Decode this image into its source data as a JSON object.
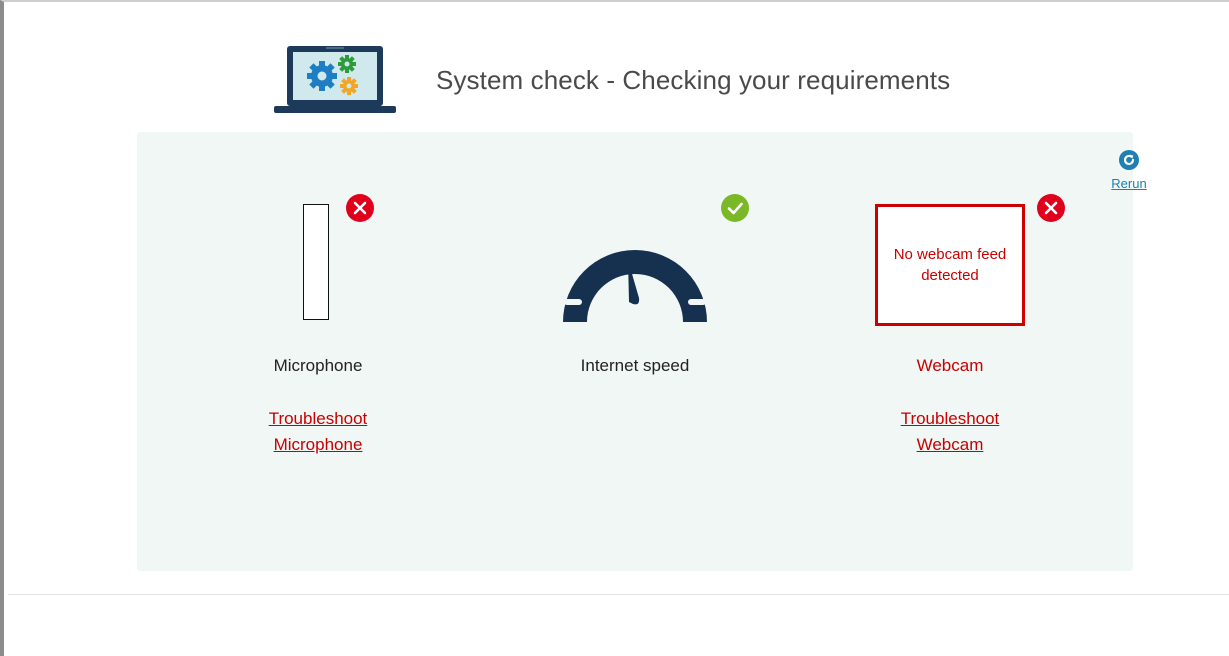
{
  "header": {
    "title": "System check - Checking your requirements",
    "icon": "laptop-gears-icon"
  },
  "rerun": {
    "label": "Rerun",
    "icon": "refresh-icon"
  },
  "checks": [
    {
      "label": "Microphone",
      "status": "fail",
      "troubleshoot_line1": "Troubleshoot",
      "troubleshoot_line2": "Microphone",
      "level": 0
    },
    {
      "label": "Internet speed",
      "status": "pass",
      "icon": "speedometer-icon"
    },
    {
      "label": "Webcam",
      "status": "fail",
      "feed_message": "No webcam feed detected",
      "troubleshoot_line1": "Troubleshoot",
      "troubleshoot_line2": "Webcam"
    }
  ],
  "colors": {
    "error": "#c80000",
    "success": "#7ab828",
    "panel_bg": "#f1f7f5",
    "link_blue": "#1d7fb5",
    "gauge": "#16304f"
  }
}
